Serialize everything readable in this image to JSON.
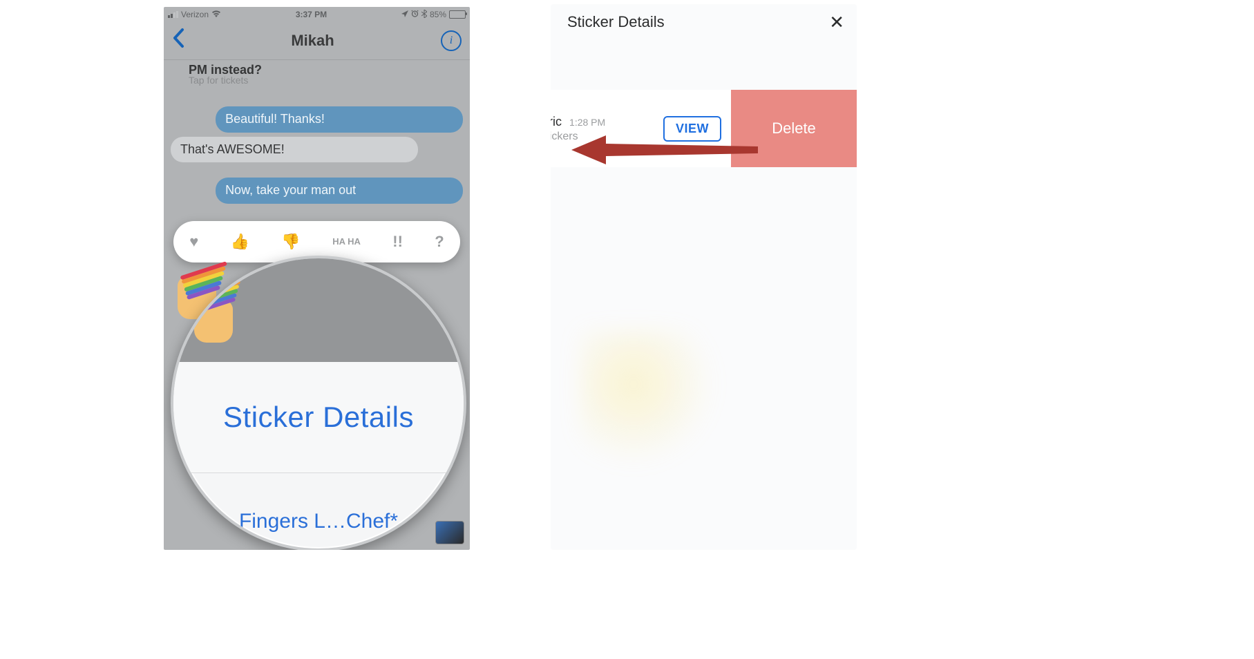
{
  "left": {
    "status": {
      "carrier": "Verizon",
      "time": "3:37 PM",
      "battery_pct": "85%",
      "battery_fill_pct": 85
    },
    "nav": {
      "title": "Mikah"
    },
    "messages": {
      "m1_tail": "PM instead?",
      "m1_sub": "Tap for tickets",
      "m2": "Beautiful! Thanks!",
      "m3": "That's AWESOME!",
      "m4": "Now, take your man out"
    },
    "tapback": {
      "heart": "♥",
      "up": "👍",
      "down": "👎",
      "haha": "HA HA",
      "bang": "!!",
      "q": "?"
    },
    "loupe": {
      "option": "Sticker Details",
      "bottom_text": "Fingers L…Chef*"
    }
  },
  "right": {
    "sheet_title": "Sticker Details",
    "close_glyph": "✕",
    "row": {
      "name_fragment": "ilpatric",
      "time": "1:28 PM",
      "pack_fragment": "ertStickers",
      "view_label": "VIEW",
      "delete_label": "Delete"
    }
  }
}
